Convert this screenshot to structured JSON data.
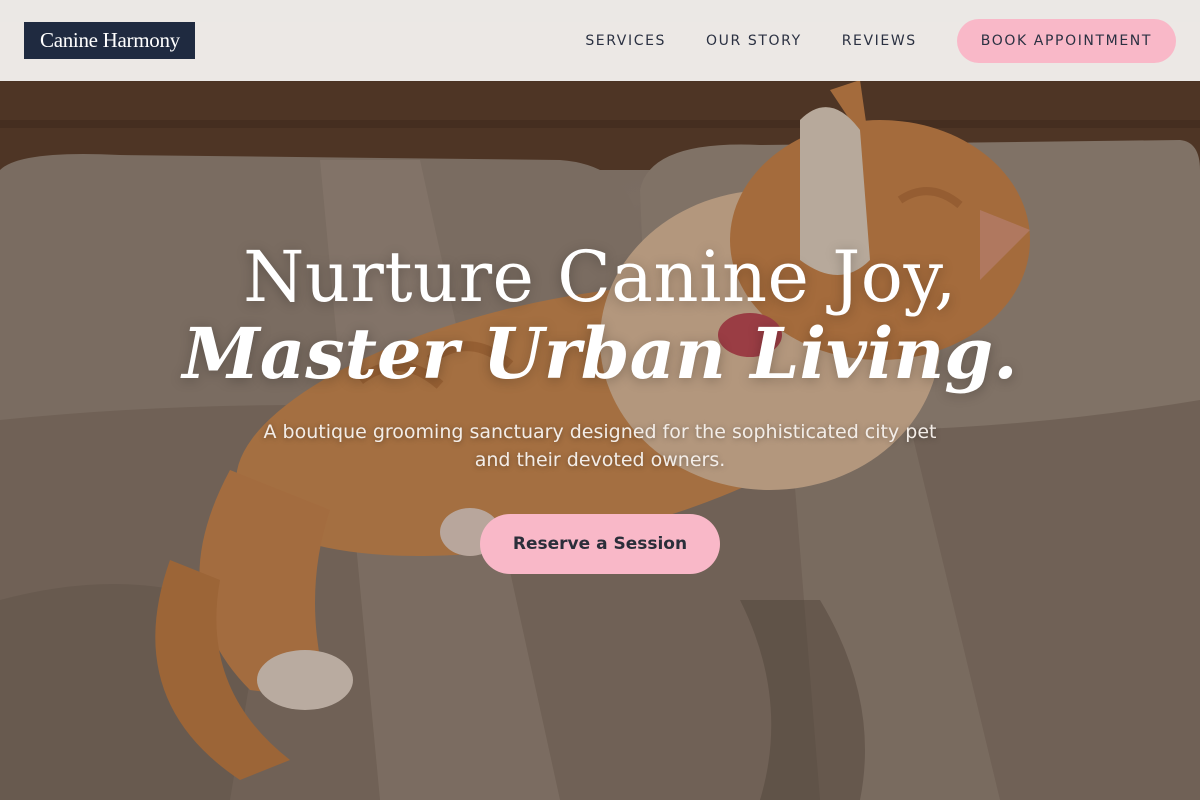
{
  "brand": {
    "name": "Canine Harmony"
  },
  "nav": {
    "links": [
      {
        "label": "SERVICES"
      },
      {
        "label": "OUR STORY"
      },
      {
        "label": "REVIEWS"
      }
    ],
    "book_label": "BOOK APPOINTMENT"
  },
  "hero": {
    "headline_line1": "Nurture Canine Joy,",
    "headline_line2": "Master Urban Living.",
    "subheadline": "A boutique grooming sanctuary designed for the sophisticated city pet and their devoted owners.",
    "cta_label": "Reserve a Session",
    "image_subject": "orange-tabby-cat-on-sofa"
  },
  "colors": {
    "accent_pink": "#f9b8c8",
    "logo_navy": "#1f2a40",
    "header_bg": "#f5f3f1",
    "text_dark": "#2b3142"
  }
}
